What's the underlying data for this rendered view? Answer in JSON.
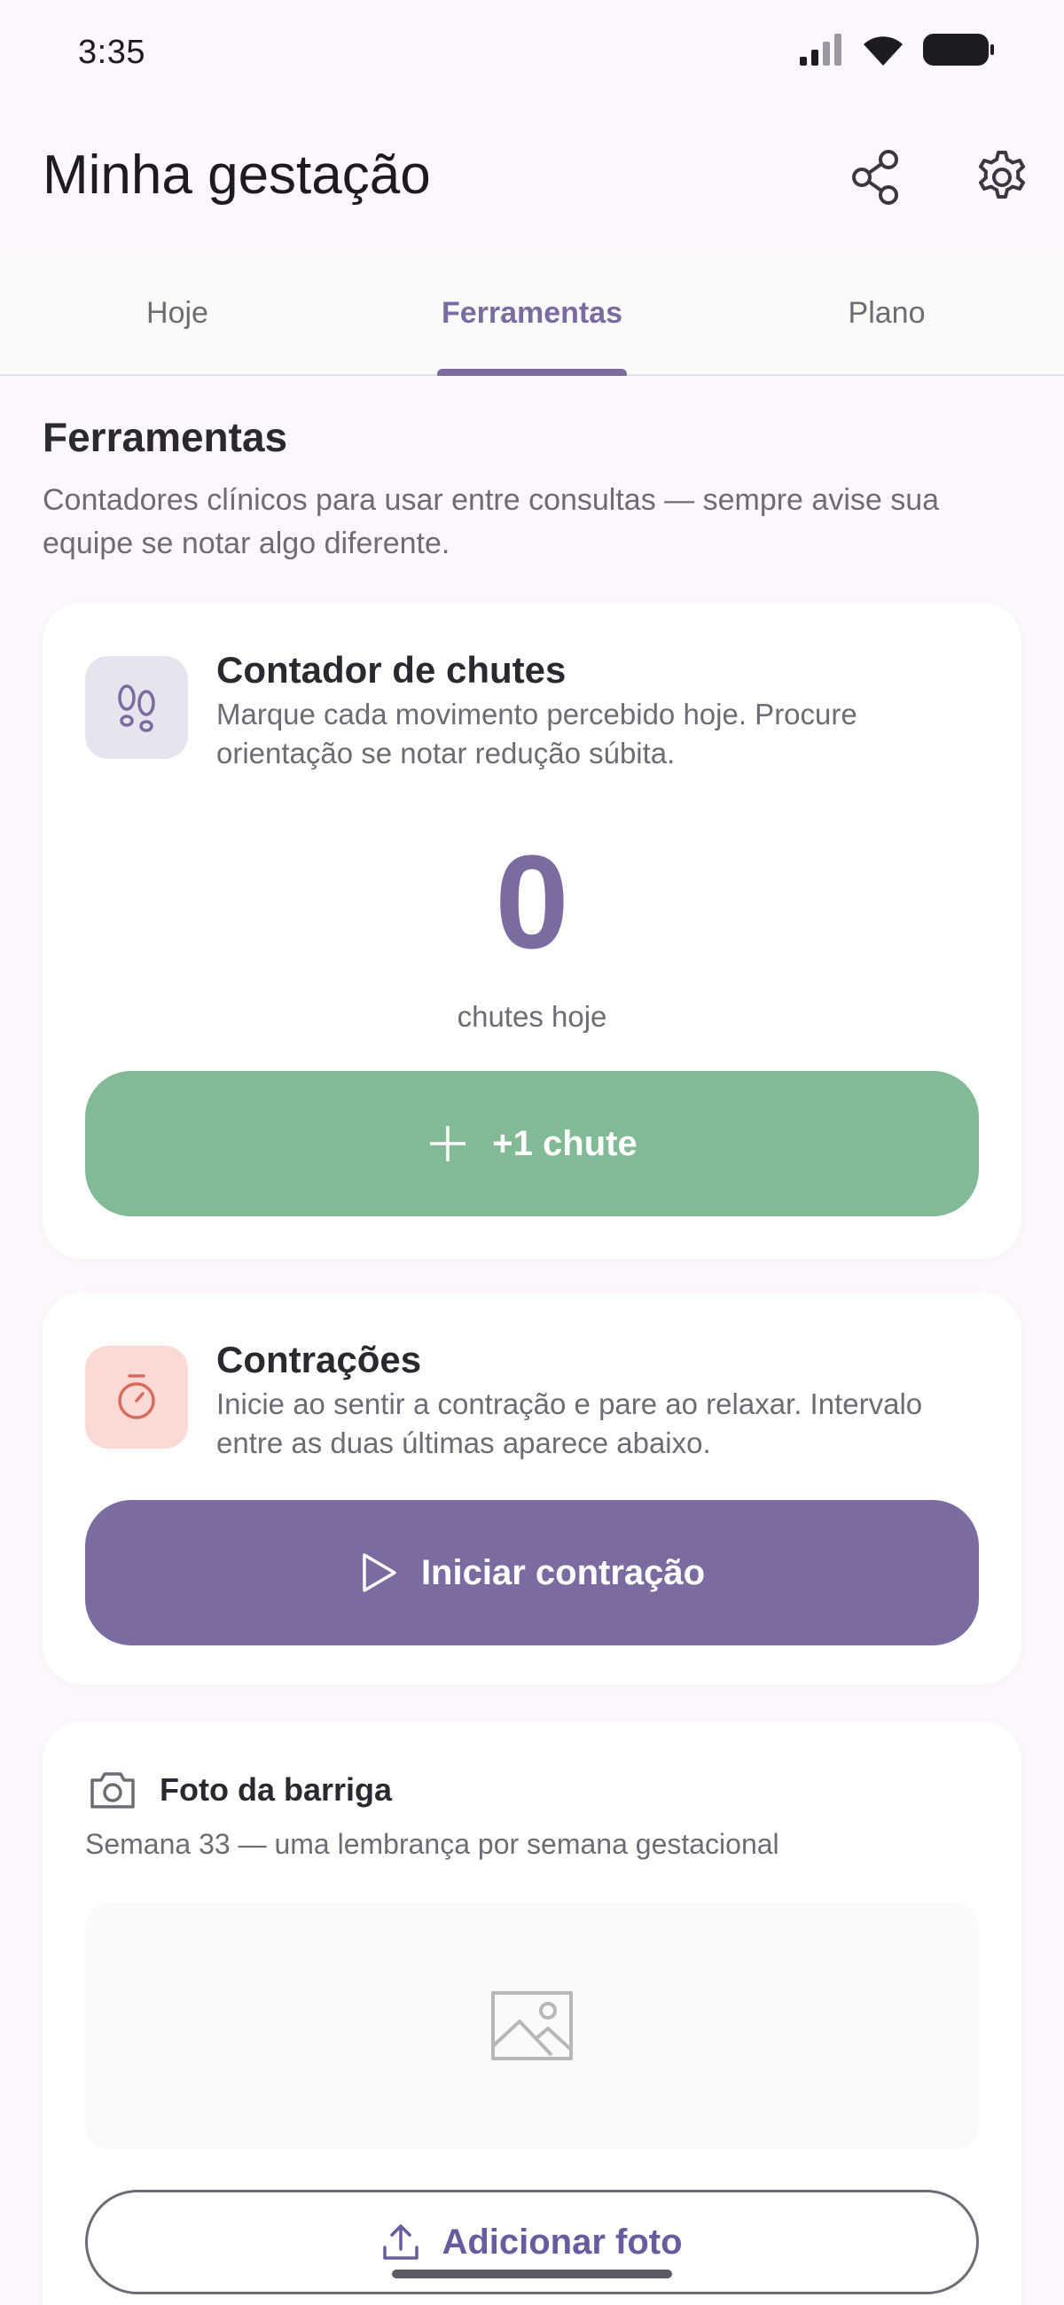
{
  "status_bar": {
    "time": "3:35",
    "icons": [
      "signal-icon",
      "wifi-icon",
      "battery-icon"
    ]
  },
  "app_bar": {
    "title": "Minha gestação",
    "actions": [
      "share-icon",
      "settings-icon"
    ]
  },
  "tabs": {
    "items": [
      "Hoje",
      "Ferramentas",
      "Plano"
    ],
    "active": "Ferramentas"
  },
  "section": {
    "title": "Ferramentas",
    "description": "Contadores clínicos para usar entre consultas — sempre avise sua equipe se notar algo diferente."
  },
  "kick_counter": {
    "title": "Contador de chutes",
    "description": "Marque cada movimento percebido hoje. Procure orientação se notar redução súbita.",
    "count": "0",
    "count_label": "chutes hoje",
    "button_label": "+1 chute",
    "icon": "footprints-icon"
  },
  "contractions": {
    "title": "Contrações",
    "description": "Inicie ao sentir a contração e pare ao relaxar. Intervalo entre as duas últimas aparece abaixo.",
    "button_label": "Iniciar contração",
    "icon": "stopwatch-icon"
  },
  "belly_photo": {
    "title": "Foto da barriga",
    "subtitle": "Semana 33 — uma lembrança por semana gestacional",
    "button_label": "Adicionar foto",
    "icon": "camera-icon"
  },
  "colors": {
    "accent": "#7b6ba1",
    "kick_button": "#81ba94",
    "contraction_tile": "#fbd9d4",
    "kick_tile": "#e8e4ee",
    "background": "#fdf7fd"
  }
}
